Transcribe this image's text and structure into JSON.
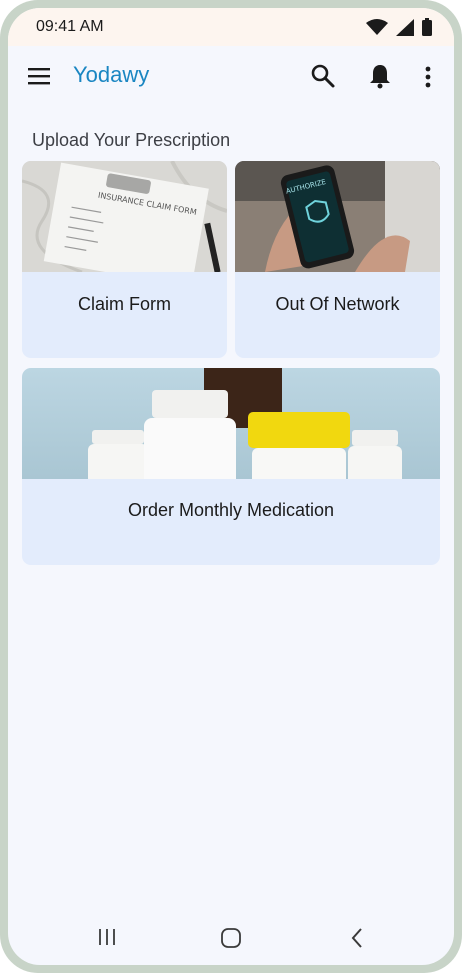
{
  "status_bar": {
    "time": "09:41 AM",
    "icons": [
      "wifi-icon",
      "cellular-signal-icon",
      "battery-icon"
    ]
  },
  "app_bar": {
    "title": "Yodawy",
    "icons": [
      "menu-icon",
      "search-icon",
      "bell-icon",
      "more-vertical-icon"
    ]
  },
  "section": {
    "title": "Upload Your Prescription"
  },
  "cards": [
    {
      "label": "Claim Form",
      "image": "insurance-claim-form-clipboard"
    },
    {
      "label": "Out Of Network",
      "image": "phone-authorize-screen"
    },
    {
      "label": "Order Monthly Medication",
      "image": "medicine-bottles"
    }
  ],
  "claim_image_text": "INSURANCE CLAIM FORM",
  "phone_image_text": "AUTHORIZE",
  "nav_bar": {
    "icons": [
      "recents-icon",
      "home-icon",
      "back-icon"
    ]
  },
  "colors": {
    "brand": "#1a86c2",
    "card_bg": "#e3ecfc",
    "screen_bg": "#f5f7fd",
    "status_bg": "#fdf5ef"
  }
}
